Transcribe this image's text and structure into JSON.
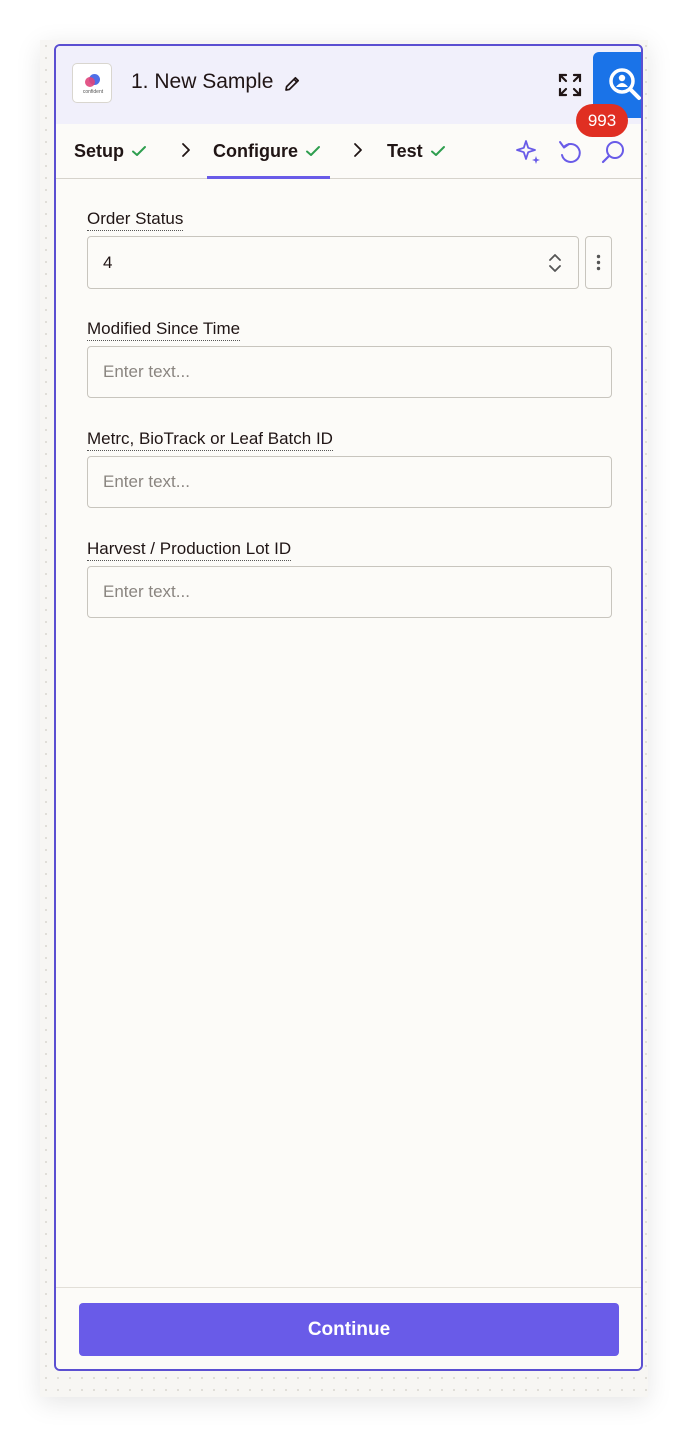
{
  "app": {
    "logo_word": "confident",
    "title": "1. New Sample"
  },
  "badge": {
    "count": "993"
  },
  "tabs": [
    {
      "label": "Setup",
      "done": true
    },
    {
      "label": "Configure",
      "done": true
    },
    {
      "label": "Test",
      "done": true
    }
  ],
  "fields": {
    "order_status": {
      "label": "Order Status",
      "value": "4"
    },
    "modified_since": {
      "label": "Modified Since Time",
      "placeholder": "Enter text..."
    },
    "batch_id": {
      "label": "Metrc, BioTrack or Leaf Batch ID",
      "placeholder": "Enter text..."
    },
    "lot_id": {
      "label": "Harvest / Production Lot ID",
      "placeholder": "Enter text..."
    }
  },
  "footer": {
    "continue_label": "Continue"
  },
  "colors": {
    "accent": "#695be8",
    "border": "#5b4fd1",
    "check": "#2e9e4f",
    "badge": "#e02f22",
    "search_button": "#1a73e8"
  }
}
